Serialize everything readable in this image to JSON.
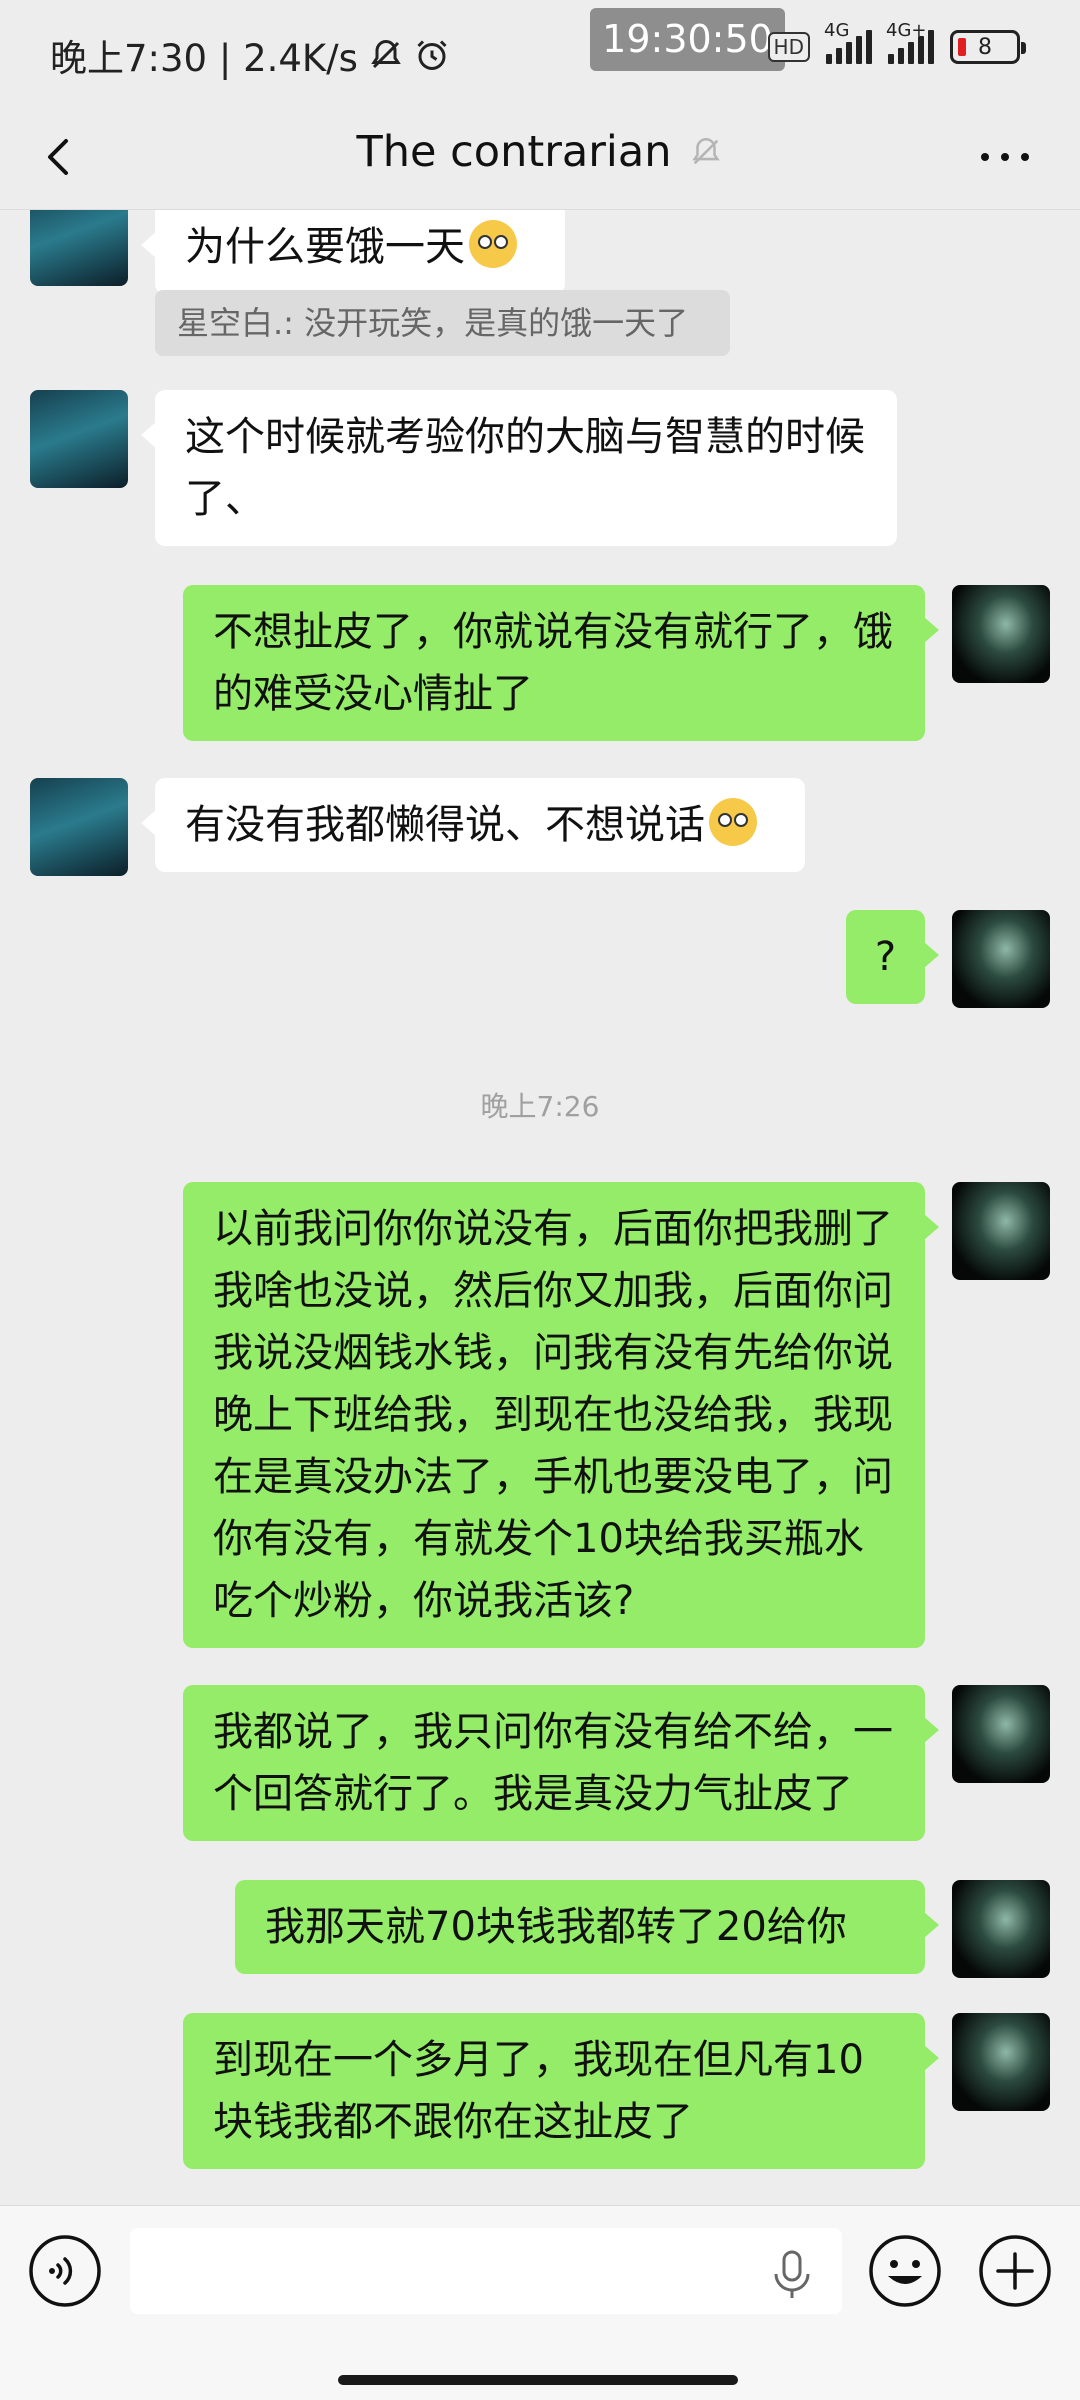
{
  "status_bar": {
    "left_text": "晚上7:30 | 2.4K/s",
    "time_overlay": "19:30:50",
    "hd_label": "HD",
    "network_1": "4G",
    "network_2": "4G+",
    "battery": "8"
  },
  "header": {
    "title": "The contrarian"
  },
  "messages": {
    "m1": {
      "text": "为什么要饿一天"
    },
    "m1_quote": {
      "text": "星空白.: 没开玩笑，是真的饿一天了"
    },
    "m2": {
      "text": "这个时候就考验你的大脑与智慧的时候了、"
    },
    "m3": {
      "text": "不想扯皮了，你就说有没有就行了，饿的难受没心情扯了"
    },
    "m4": {
      "text": "有没有我都懒得说、不想说话"
    },
    "m5": {
      "text": "?"
    },
    "timestamp": "晚上7:26",
    "m6": {
      "text": "以前我问你你说没有，后面你把我删了我啥也没说，然后你又加我，后面你问我说没烟钱水钱，问我有没有先给你说晚上下班给我，到现在也没给我，我现在是真没办法了，手机也要没电了，问你有没有，有就发个10块给我买瓶水吃个炒粉，你说我活该?"
    },
    "m7": {
      "text": "我都说了，我只问你有没有给不给，一个回答就行了。我是真没力气扯皮了"
    },
    "m8": {
      "text": "我那天就70块钱我都转了20给你"
    },
    "m9": {
      "text": "到现在一个多月了，我现在但凡有10块钱我都不跟你在这扯皮了"
    }
  },
  "input_bar": {
    "placeholder": ""
  },
  "colors": {
    "background": "#ededed",
    "bubble_out": "#95ec69",
    "bubble_in": "#ffffff"
  },
  "icons": [
    "back-arrow-icon",
    "mute-bell-icon",
    "more-dots-icon",
    "voice-icon",
    "mic-icon",
    "emoji-icon",
    "plus-icon"
  ]
}
